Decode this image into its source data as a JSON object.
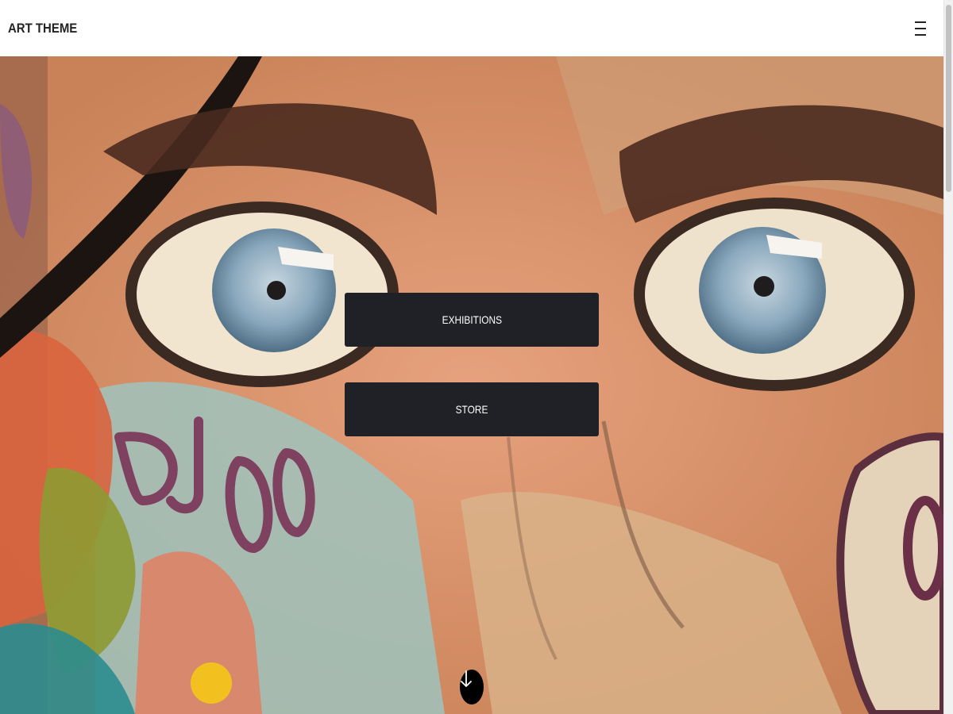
{
  "header": {
    "logo": "ART THEME",
    "menu_icon": "hamburger-menu-icon"
  },
  "hero": {
    "background_description_icon": "graffiti-mural-image",
    "buttons": [
      {
        "label": "EXHIBITIONS"
      },
      {
        "label": "STORE"
      }
    ],
    "scroll_icon": "arrow-down-icon"
  },
  "colors": {
    "button_bg": "#1f2126",
    "button_text": "#ffffff",
    "header_bg": "#ffffff",
    "logo_text": "#222222"
  }
}
